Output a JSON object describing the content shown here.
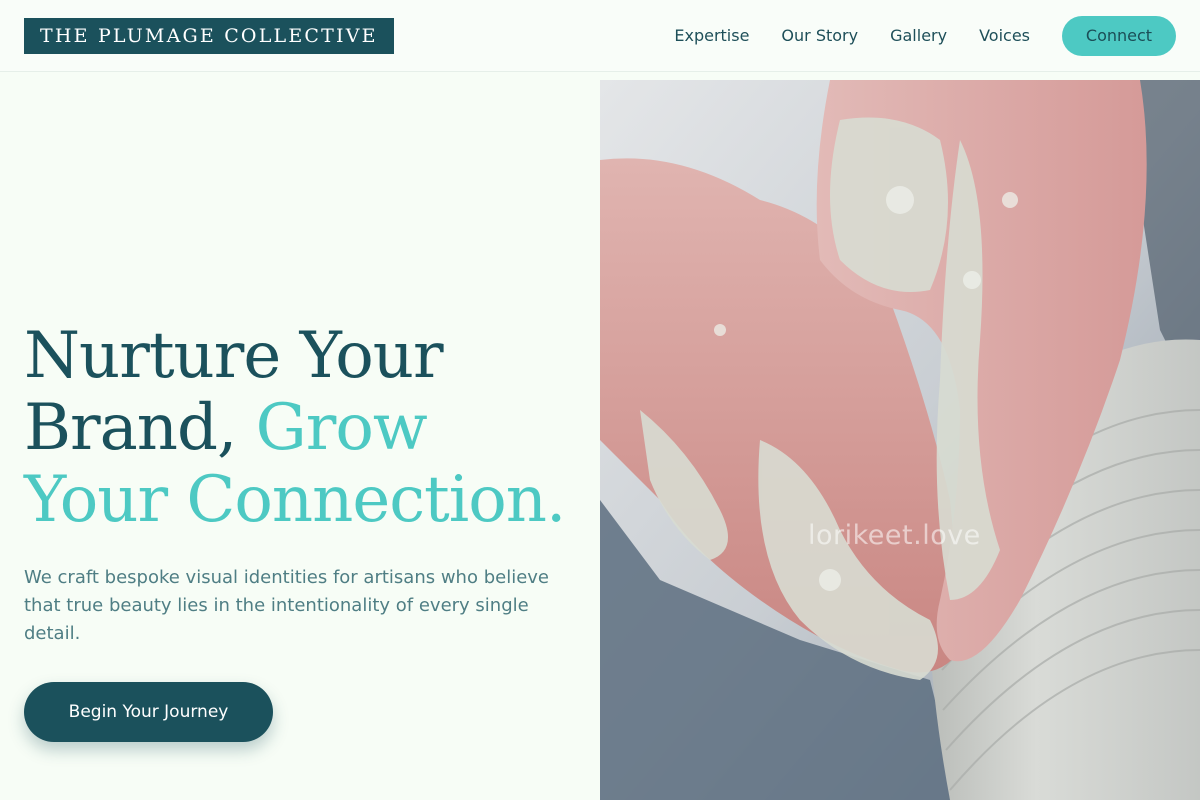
{
  "brand": {
    "name": "THE PLUMAGE COLLECTIVE"
  },
  "nav": {
    "items": [
      {
        "label": "Expertise"
      },
      {
        "label": "Our Story"
      },
      {
        "label": "Gallery"
      },
      {
        "label": "Voices"
      }
    ],
    "connect_label": "Connect"
  },
  "hero": {
    "headline_part1": "Nurture Your Brand, ",
    "headline_part2": "Grow Your Connection.",
    "subtext": "We craft bespoke visual identities for artisans who believe that true beauty lies in the intentionality of every single detail.",
    "cta_label": "Begin Your Journey",
    "image_watermark": "lorikeet.love"
  },
  "colors": {
    "primary": "#1b515c",
    "accent": "#4dc9c3",
    "background": "#f7fdf6",
    "body_text": "#4f7e84"
  }
}
